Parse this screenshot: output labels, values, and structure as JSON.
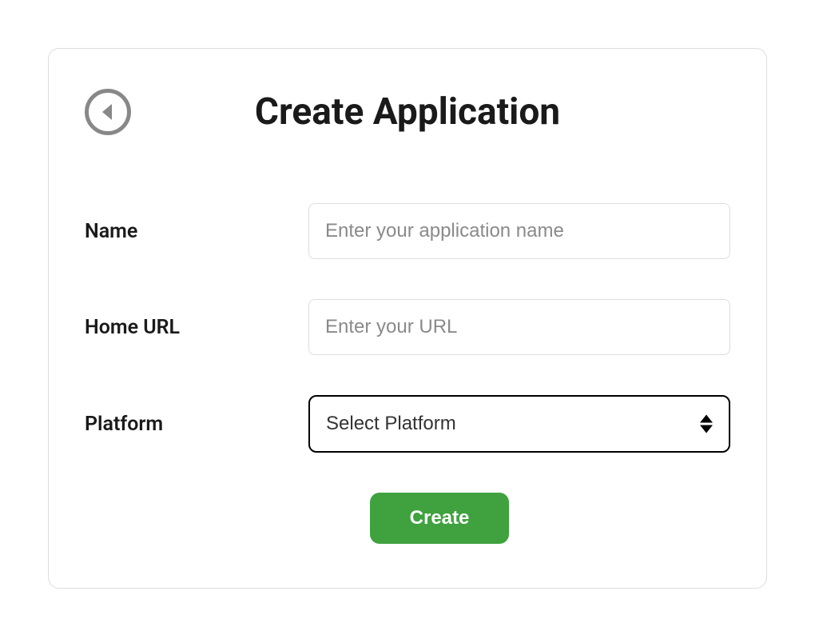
{
  "header": {
    "title": "Create Application"
  },
  "form": {
    "name": {
      "label": "Name",
      "placeholder": "Enter your application name",
      "value": ""
    },
    "homeUrl": {
      "label": "Home URL",
      "placeholder": "Enter your URL",
      "value": ""
    },
    "platform": {
      "label": "Platform",
      "selected": "Select Platform"
    }
  },
  "actions": {
    "createLabel": "Create"
  }
}
